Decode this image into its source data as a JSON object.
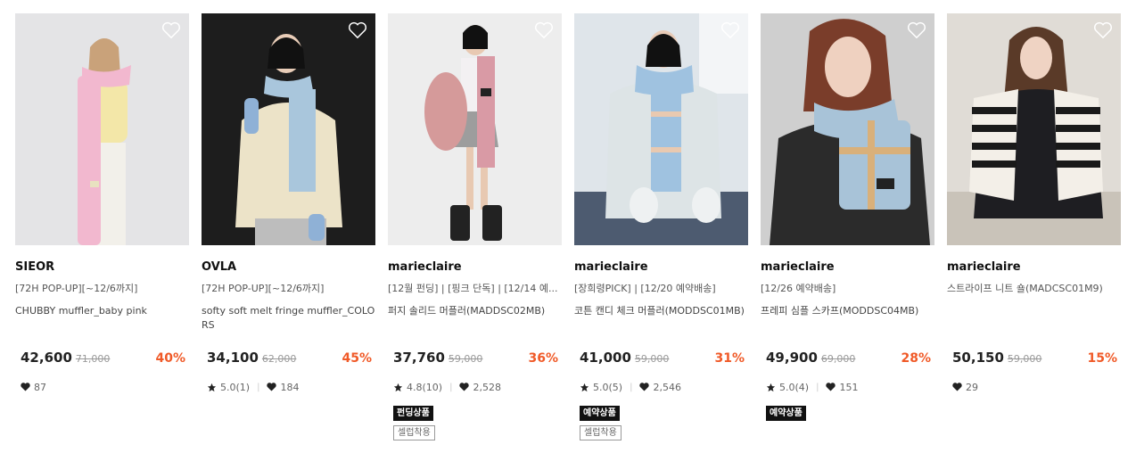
{
  "products": [
    {
      "brand": "SIEOR",
      "subtitle": "[72H POP-UP][~12/6까지]",
      "name": "CHUBBY muffler_baby pink",
      "price": "42,600",
      "original_price": "71,000",
      "discount": "40%",
      "likes": "87",
      "bg": "#e4e4e6",
      "scarf": "#f2b8cf"
    },
    {
      "brand": "OVLA",
      "subtitle": "[72H POP-UP][~12/6까지]",
      "name": "softy soft melt fringe muffler_COLORS",
      "price": "34,100",
      "original_price": "62,000",
      "discount": "45%",
      "rating": "5.0(1)",
      "likes": "184",
      "bg": "#1d1d1d",
      "scarf": "#a9c6dc"
    },
    {
      "brand": "marieclaire",
      "subtitle": "[12월 펀딩] | [핑크 단독] | [12/14 예...",
      "name": "퍼지 솔리드 머플러(MADDSC02MB)",
      "price": "37,760",
      "original_price": "59,000",
      "discount": "36%",
      "rating": "4.8(10)",
      "likes": "2,528",
      "tag_primary": "펀딩상품",
      "tag_secondary": "셀럽착용",
      "bg": "#ededed",
      "scarf": "#d99aa5"
    },
    {
      "brand": "marieclaire",
      "subtitle": "[장희령PICK] | [12/20 예약배송]",
      "name": "코튼 캔디 체크 머플러(MODDSC01MB)",
      "price": "41,000",
      "original_price": "59,000",
      "discount": "31%",
      "rating": "5.0(5)",
      "likes": "2,546",
      "tag_primary": "예약상품",
      "tag_secondary": "셀럽착용",
      "bg": "#dfe5ea",
      "scarf": "#9fc2e0"
    },
    {
      "brand": "marieclaire",
      "subtitle": "[12/26 예약배송]",
      "name": "프레피 심플 스카프(MODDSC04MB)",
      "price": "49,900",
      "original_price": "69,000",
      "discount": "28%",
      "rating": "5.0(4)",
      "likes": "151",
      "tag_primary": "예약상품",
      "bg": "#cfcfcf",
      "scarf": "#a8c3d8"
    },
    {
      "brand": "marieclaire",
      "subtitle": "스트라이프 니트 숄(MADCSC01M9)",
      "price": "50,150",
      "original_price": "59,000",
      "discount": "15%",
      "likes": "29",
      "bg": "#e0dcd6",
      "scarf": "#1a1a1a"
    }
  ]
}
